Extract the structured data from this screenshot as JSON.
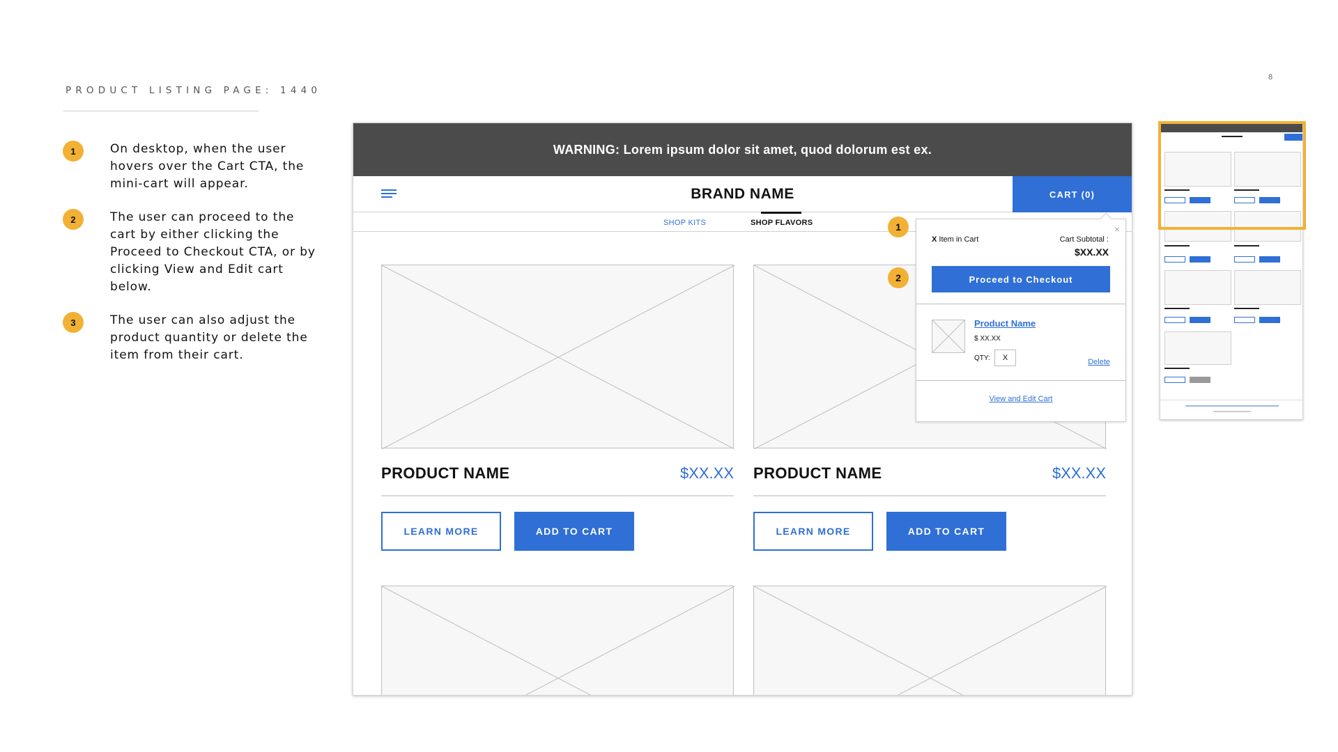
{
  "slide": {
    "title": "PRODUCT LISTING PAGE: 1440",
    "page_number": "8",
    "notes": [
      {
        "num": "1",
        "text": "On desktop, when the user hovers over the Cart CTA, the mini-cart will appear."
      },
      {
        "num": "2",
        "text": "The user can proceed to the cart by either clicking the Proceed to Checkout CTA, or by clicking View and Edit cart below."
      },
      {
        "num": "3",
        "text": "The user can also adjust the product quantity or delete the item from their cart."
      }
    ]
  },
  "site": {
    "warning": "WARNING: Lorem ipsum dolor sit amet, quod dolorum est ex.",
    "brand": "BRAND NAME",
    "cart_label": "CART (0)",
    "nav": {
      "kits": "SHOP KITS",
      "flavors": "SHOP FLAVORS"
    },
    "products": [
      {
        "name": "PRODUCT NAME",
        "price": "$XX.XX",
        "learn_more": "LEARN MORE",
        "add_to_cart": "ADD TO CART"
      },
      {
        "name": "PRODUCT NAME",
        "price": "$XX.XX",
        "learn_more": "LEARN MORE",
        "add_to_cart": "ADD TO CART"
      }
    ]
  },
  "mini_cart": {
    "close": "×",
    "count_x": "X",
    "count_label": " Item in Cart",
    "subtotal_label": "Cart Subtotal :",
    "subtotal": "$XX.XX",
    "checkout": "Proceed to Checkout",
    "product_name": "Product Name",
    "product_price": "$ XX.XX",
    "qty_label": "QTY:",
    "qty_value": "X",
    "delete": "Delete",
    "view_edit": "View and Edit Cart"
  },
  "markers": {
    "one": "1",
    "two": "2"
  },
  "colors": {
    "accent": "#2f6fd6",
    "marker": "#f2b134",
    "warning_bg": "#4b4b4b"
  }
}
